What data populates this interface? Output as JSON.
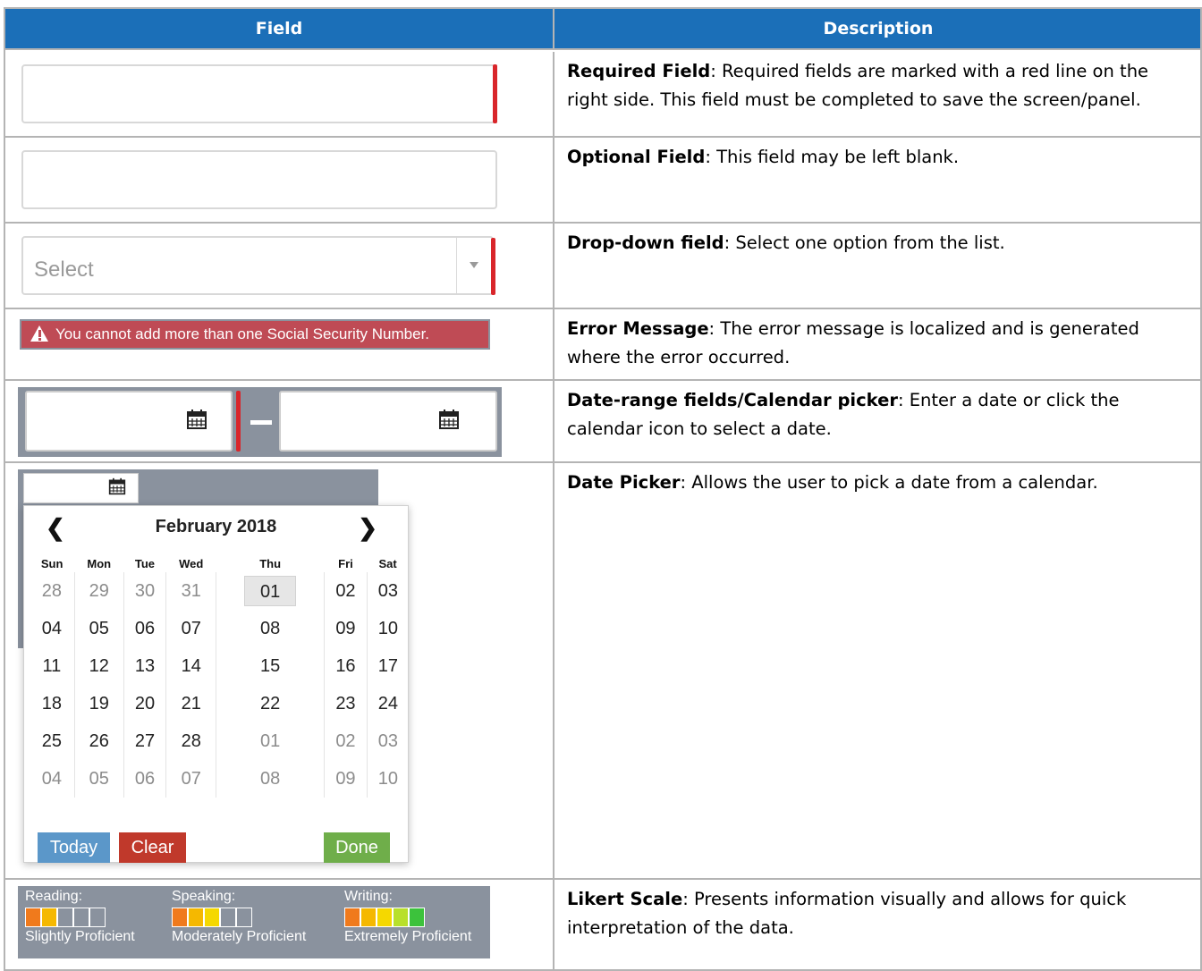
{
  "header": {
    "field": "Field",
    "description": "Description"
  },
  "rows": [
    {
      "name": "Required Field",
      "text": ": Required fields are marked with a red line on the right side. This field must be completed to save the screen/panel."
    },
    {
      "name": "Optional Field",
      "text": ": This field may be left blank."
    },
    {
      "name": "Drop-down field",
      "text": ": Select one option from the list."
    },
    {
      "name": "Error Message",
      "text": ": The error message is localized and is generated where the error occurred."
    },
    {
      "name": "Date-range fields/Calendar picker",
      "text": ":  Enter a date or click the calendar icon to select a date."
    },
    {
      "name": "Date Picker",
      "text": ":  Allows the user to pick a date from a calendar."
    },
    {
      "name": "Likert Scale",
      "text": ": Presents information visually and allows for quick interpretation of the data."
    }
  ],
  "dropdown": {
    "placeholder": "Select"
  },
  "error_example": {
    "message": "You cannot add more than one Social Security Number."
  },
  "datepicker": {
    "month_label": "February 2018",
    "weekdays": [
      "Sun",
      "Mon",
      "Tue",
      "Wed",
      "Thu",
      "Fri",
      "Sat"
    ],
    "weeks": [
      [
        "28",
        "29",
        "30",
        "31",
        "01",
        "02",
        "03"
      ],
      [
        "04",
        "05",
        "06",
        "07",
        "08",
        "09",
        "10"
      ],
      [
        "11",
        "12",
        "13",
        "14",
        "15",
        "16",
        "17"
      ],
      [
        "18",
        "19",
        "20",
        "21",
        "22",
        "23",
        "24"
      ],
      [
        "25",
        "26",
        "27",
        "28",
        "01",
        "02",
        "03"
      ],
      [
        "04",
        "05",
        "06",
        "07",
        "08",
        "09",
        "10"
      ]
    ],
    "selected": "01",
    "buttons": {
      "today": "Today",
      "clear": "Clear",
      "done": "Done"
    },
    "colors": {
      "today": "#5b97c9",
      "clear": "#c0392b",
      "done": "#6fae4a",
      "selected_bg": "#e6e6e6"
    }
  },
  "likert": [
    {
      "label": "Reading:",
      "level": "Slightly Proficient",
      "filled": 2,
      "total": 5,
      "colors": [
        "#f07a1c",
        "#f5b800"
      ]
    },
    {
      "label": "Speaking:",
      "level": "Moderately Proficient",
      "filled": 3,
      "total": 5,
      "colors": [
        "#f07a1c",
        "#f5b800",
        "#f5d800"
      ]
    },
    {
      "label": "Writing:",
      "level": "Extremely Proficient",
      "filled": 5,
      "total": 5,
      "colors": [
        "#f07a1c",
        "#f5b800",
        "#f5d800",
        "#b8e02a",
        "#3cc23c"
      ]
    }
  ],
  "colors": {
    "header_bg": "#1b6fb8",
    "required_marker": "#d9262b",
    "error_bg": "#bf4b55",
    "panel_gray": "#8a929e"
  },
  "icons": [
    "warning-icon",
    "calendar-icon",
    "chevron-left-icon",
    "chevron-right-icon",
    "dropdown-caret-icon"
  ]
}
